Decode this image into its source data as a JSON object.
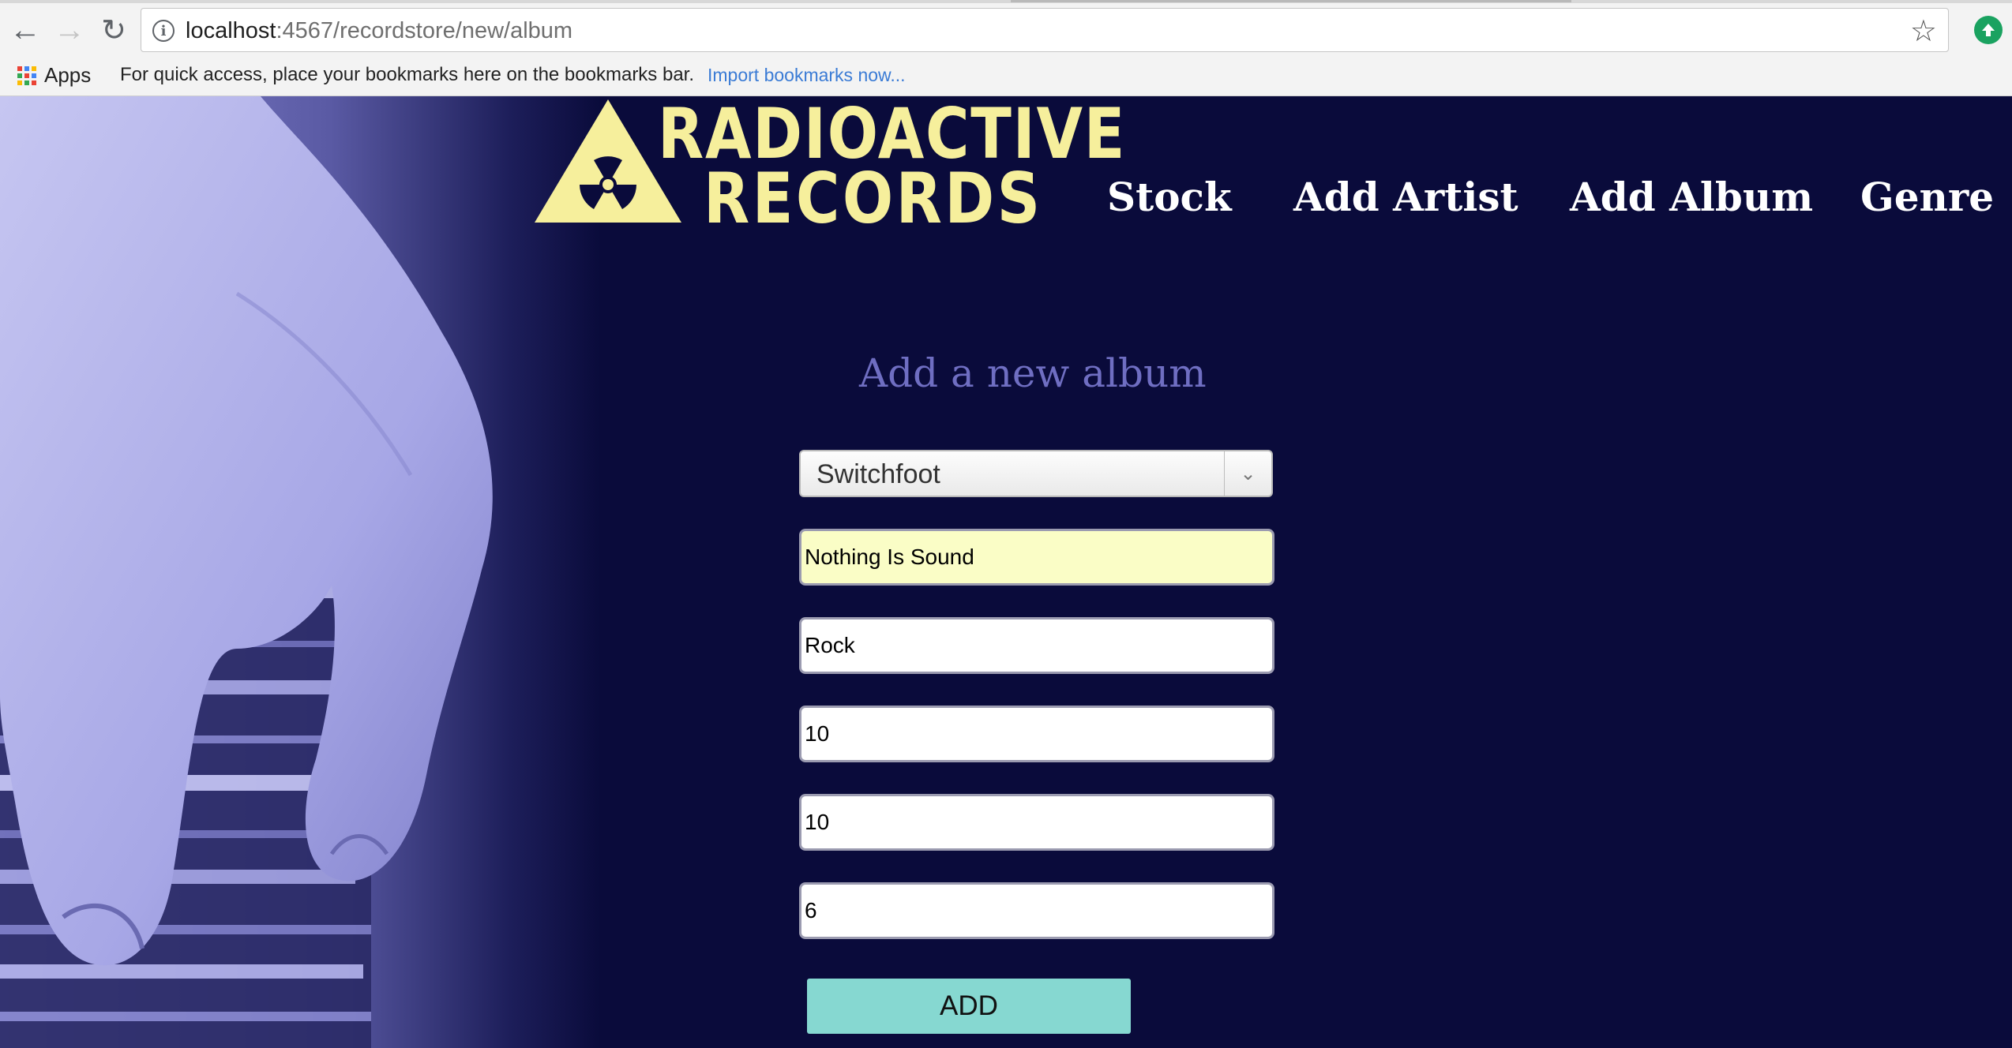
{
  "browser": {
    "url_host": "localhost",
    "url_path": ":4567/recordstore/new/album",
    "bookmarks": {
      "apps_label": "Apps",
      "hint": "For quick access, place your bookmarks here on the bookmarks bar.",
      "import_link": "Import bookmarks now..."
    },
    "icons": [
      "back-arrow-icon",
      "forward-arrow-icon",
      "reload-icon",
      "info-icon",
      "star-icon",
      "extension-icon",
      "apps-grid-icon"
    ]
  },
  "site": {
    "logo_line1": "RADIOACTIVE",
    "logo_line2": "RECORDS",
    "nav": [
      "Stock",
      "Add Artist",
      "Add Album",
      "Genre"
    ]
  },
  "form": {
    "title": "Add a new album",
    "artist_select": "Switchfoot",
    "album_title": "Nothing Is Sound",
    "genre": "Rock",
    "field4": "10",
    "field5": "10",
    "field6": "6",
    "submit_label": "ADD"
  },
  "colors": {
    "page_bg": "#0a0b3b",
    "logo": "#f6ef9c",
    "title": "#6f6ec2",
    "button": "#86d8d1",
    "autofill": "#fafdc6"
  }
}
